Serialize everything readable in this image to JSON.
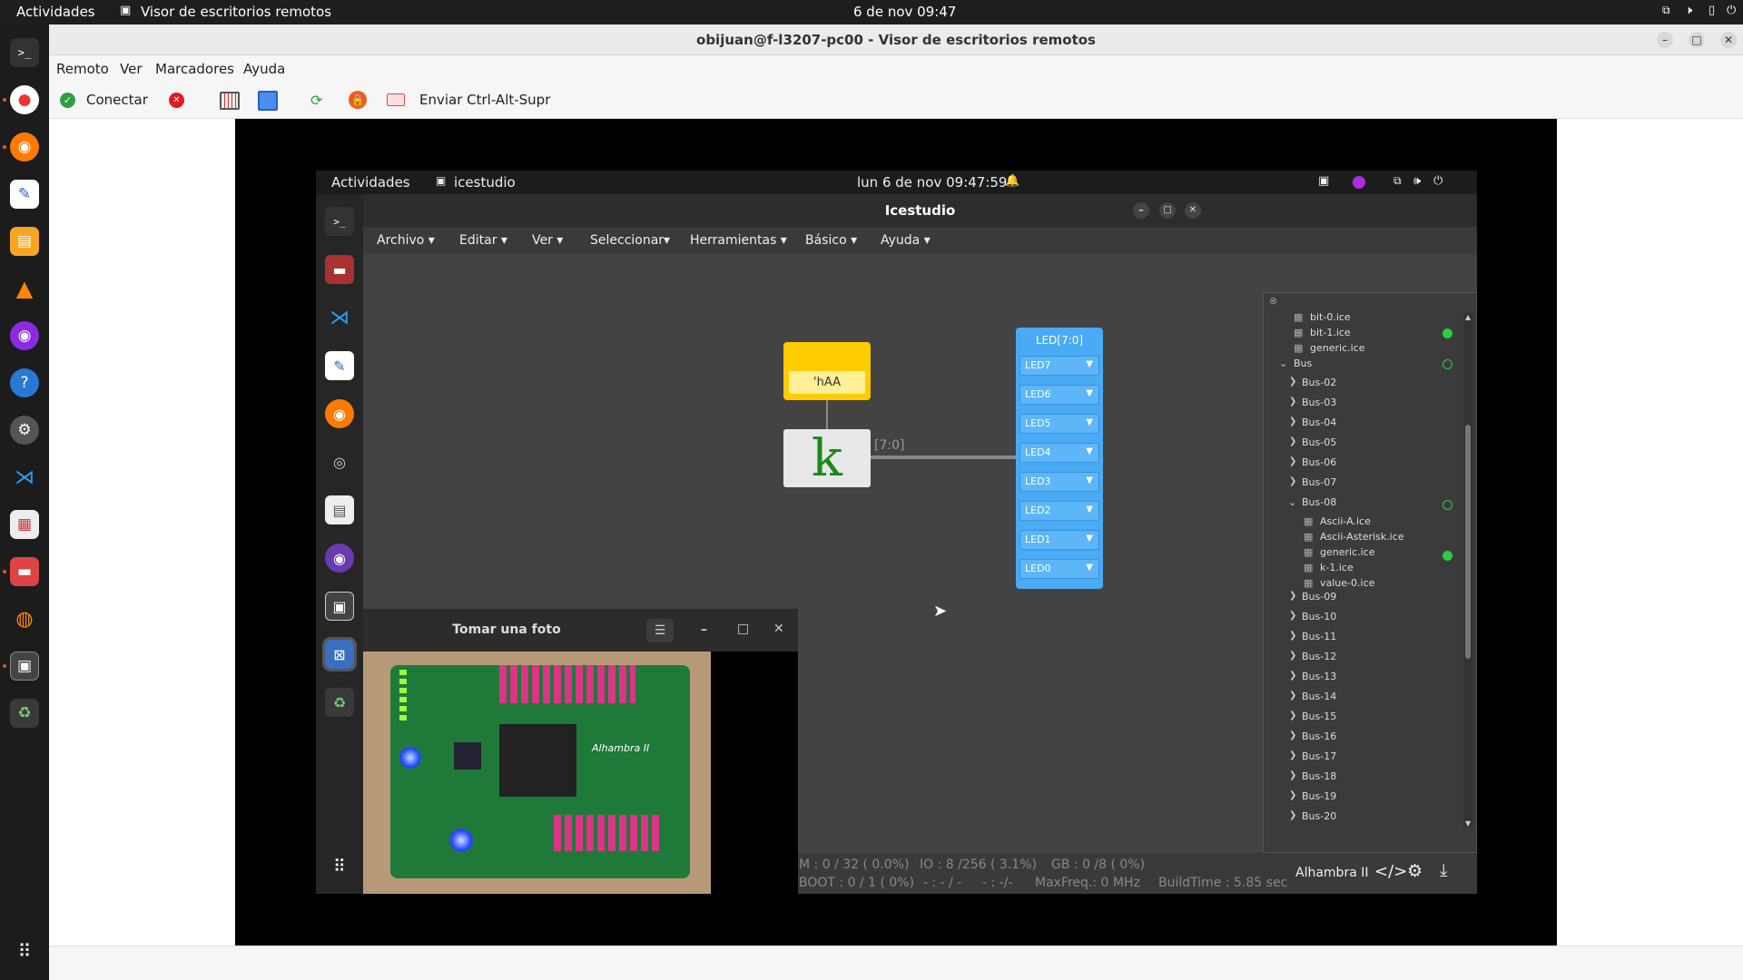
{
  "os_topbar": {
    "activities": "Actividades",
    "app": "Visor de escritorios remotos",
    "clock": "6 de nov  09:47"
  },
  "window": {
    "title": "obijuan@f-l3207-pc00 - Visor de escritorios remotos"
  },
  "menu": [
    "Remoto",
    "Ver",
    "Marcadores",
    "Ayuda"
  ],
  "toolbar": {
    "connect": "Conectar",
    "send_keys": "Enviar Ctrl-Alt-Supr"
  },
  "remote_topbar": {
    "activities": "Actividades",
    "app": "icestudio",
    "clock": "lun 6 de nov  09:47:59"
  },
  "icestudio": {
    "title": "Icestudio",
    "menu": [
      "Archivo ▾",
      "Editar ▾",
      "Ver ▾",
      "Seleccionar▾",
      "Herramientas ▾",
      "Básico ▾",
      "Ayuda ▾"
    ],
    "constant_value": "'hAA",
    "k_label": "k",
    "wire_label": "[7:0]",
    "led_title": "LED[7:0]",
    "leds": [
      "LED7",
      "LED6",
      "LED5",
      "LED4",
      "LED3",
      "LED2",
      "LED1",
      "LED0"
    ]
  },
  "collection_tree": {
    "top_files": [
      "bit-0.ice",
      "bit-1.ice",
      "generic.ice"
    ],
    "bus_label": "Bus",
    "bus_before": [
      "Bus-02",
      "Bus-03",
      "Bus-04",
      "Bus-05",
      "Bus-06",
      "Bus-07"
    ],
    "bus_open": "Bus-08",
    "bus08_files": [
      "Ascii-A.ice",
      "Ascii-Asterisk.ice",
      "generic.ice",
      "k-1.ice",
      "value-0.ice"
    ],
    "bus_after": [
      "Bus-09",
      "Bus-10",
      "Bus-11",
      "Bus-12",
      "Bus-13",
      "Bus-14",
      "Bus-15",
      "Bus-16",
      "Bus-17",
      "Bus-18",
      "Bus-19",
      "Bus-20"
    ]
  },
  "footer": {
    "m": "M : 0 / 32 ( 0.0%)",
    "io": "IO : 8 /256  ( 3.1%)",
    "gb": "GB : 0 /8  ( 0%)",
    "boot": "BOOT : 0 / 1 ( 0%)",
    "dash1": "- : - / -",
    "dash2": "- : -/-",
    "maxfreq": "MaxFreq.: 0 MHz",
    "buildtime": "BuildTime : 5.85 sec",
    "board": "Alhambra II"
  },
  "photo_window": {
    "title": "Tomar una foto",
    "board_text": "Alhambra II"
  }
}
